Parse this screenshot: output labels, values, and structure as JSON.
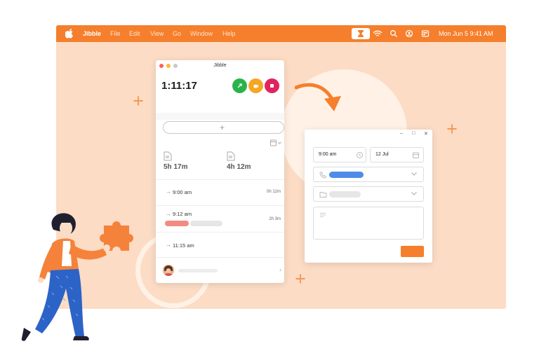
{
  "menubar": {
    "app_name": "Jibble",
    "items": [
      "File",
      "Edit",
      "View",
      "Go",
      "Window",
      "Help"
    ],
    "clock": "Mon Jun 5  9:41 AM",
    "tray_icons": [
      "jibble-hourglass-icon",
      "wifi-icon",
      "search-icon",
      "user-circle-icon",
      "control-center-icon"
    ]
  },
  "widget": {
    "title": "Jibble",
    "timer": "1:11:17",
    "buttons": [
      "switch-activity",
      "break",
      "clock-out"
    ],
    "add_symbol": "+",
    "stats": [
      {
        "value": "5h 17m"
      },
      {
        "value": "4h 12m"
      }
    ],
    "entries": [
      {
        "time": "9:00 am",
        "duration": "0h 12m"
      },
      {
        "time": "9:12 am",
        "duration": "2h 3m"
      },
      {
        "time": "11:15 am",
        "duration": ""
      }
    ]
  },
  "dialog": {
    "time_value": "9:00 am",
    "date_value": "12 Jul"
  },
  "colors": {
    "brand_orange": "#f57f2c",
    "background_peach": "#fcdcc5",
    "green": "#2ab34a",
    "amber": "#f5a623",
    "red": "#e0245e",
    "blue": "#4f8ce8"
  }
}
